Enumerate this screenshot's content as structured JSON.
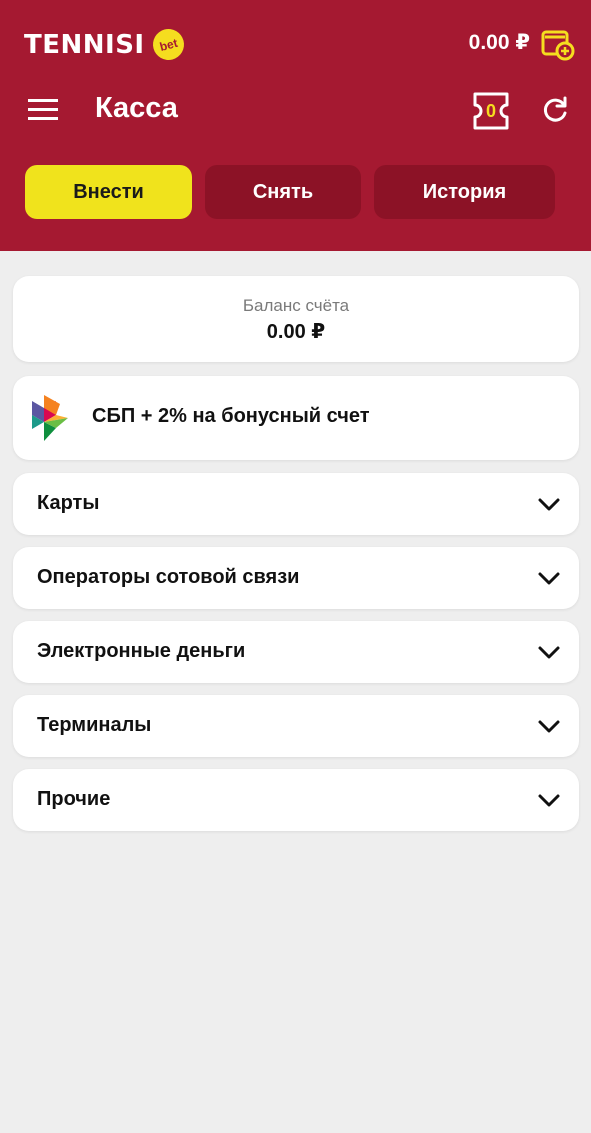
{
  "header": {
    "logo_text": "TENNISI",
    "logo_badge": "bet",
    "balance": "0.00 ₽",
    "title": "Касса",
    "coupon_count": "0",
    "icons": [
      "menu-icon",
      "wallet-add-icon",
      "coupon-icon",
      "refresh-icon"
    ]
  },
  "tabs": [
    {
      "label": "Внести",
      "active": true
    },
    {
      "label": "Снять",
      "active": false
    },
    {
      "label": "История",
      "active": false
    }
  ],
  "balance_card": {
    "label": "Баланс счёта",
    "value": "0.00 ₽"
  },
  "sbp": {
    "label": "СБП + 2% на бонусный счет",
    "icon": "sbp-logo"
  },
  "methods": [
    {
      "label": "Карты"
    },
    {
      "label": "Операторы сотовой связи"
    },
    {
      "label": "Электронные деньги"
    },
    {
      "label": "Терминалы"
    },
    {
      "label": "Прочие"
    }
  ],
  "colors": {
    "header_bg": "#a51931",
    "accent_yellow": "#f0e31c",
    "tab_inactive": "#8c1226",
    "page_bg": "#eeeeee"
  }
}
